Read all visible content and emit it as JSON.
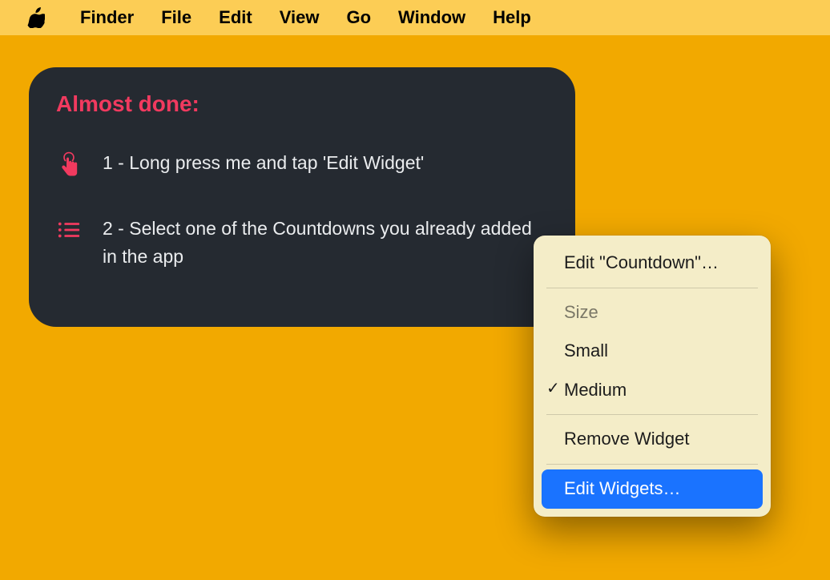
{
  "menubar": {
    "app_name": "Finder",
    "items": [
      "File",
      "Edit",
      "View",
      "Go",
      "Window",
      "Help"
    ]
  },
  "widget": {
    "title": "Almost done:",
    "step1": "1 - Long press me and tap 'Edit Widget'",
    "step2": "2 - Select one of the Countdowns you already added in the app"
  },
  "context_menu": {
    "edit_item": "Edit \"Countdown\"…",
    "size_label": "Size",
    "small": "Small",
    "medium": "Medium",
    "remove": "Remove Widget",
    "edit_widgets": "Edit Widgets…"
  }
}
